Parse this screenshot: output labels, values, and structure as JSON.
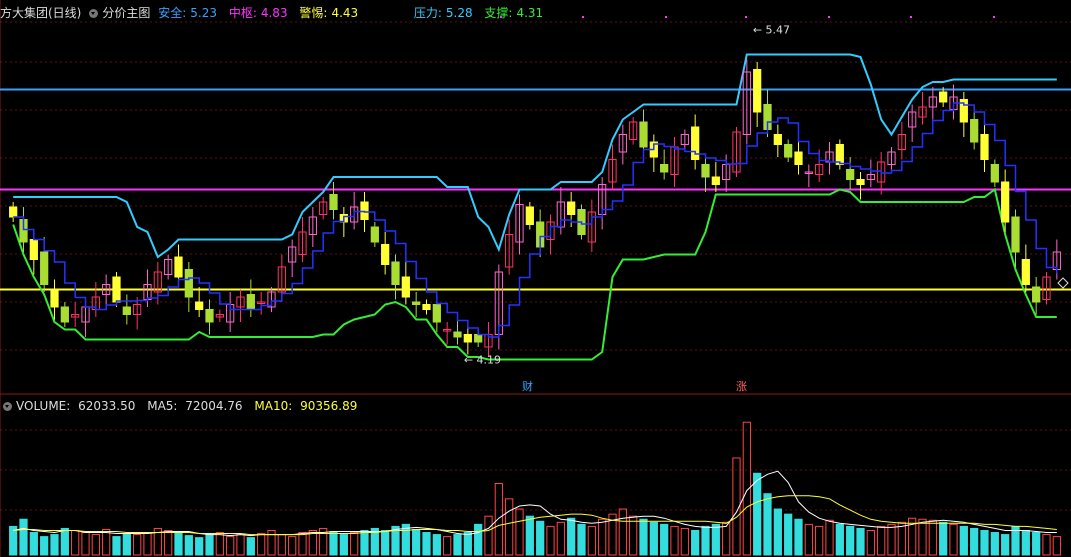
{
  "header": {
    "stock_name": "方大集团(日线)",
    "main_chart_label": "分价主图",
    "safe": {
      "label": "安全:",
      "value": "5.23",
      "color": "#3aa0ff"
    },
    "center": {
      "label": "中枢:",
      "value": "4.83",
      "color": "#ff33ff"
    },
    "alert": {
      "label": "警惕:",
      "value": "4.43",
      "color": "#ffff33"
    },
    "pressure": {
      "label": "压力:",
      "value": "5.28",
      "color": "#33ccff"
    },
    "support": {
      "label": "支撑:",
      "value": "4.31",
      "color": "#33ee33"
    }
  },
  "volume_header": {
    "volume": {
      "label": "VOLUME:",
      "value": "62033.50",
      "color": "#dddddd"
    },
    "ma5": {
      "label": "MA5:",
      "value": "72004.76",
      "color": "#dddddd"
    },
    "ma10": {
      "label": "MA10:",
      "value": "90356.89",
      "color": "#ffff33"
    }
  },
  "markers": {
    "high_label": "5.47",
    "low_label": "4.19",
    "cai_badge": "财",
    "zhang_badge": "涨"
  },
  "chart_data": {
    "type": "candlestick",
    "price_range": [
      4.1,
      5.5
    ],
    "ref_lines": [
      {
        "name": "安全",
        "value": 5.23,
        "color": "#3aa0ff"
      },
      {
        "name": "中枢",
        "value": 4.83,
        "color": "#ff33ff"
      },
      {
        "name": "警惕",
        "value": 4.43,
        "color": "#ffff33"
      }
    ],
    "closes": [
      4.72,
      4.62,
      4.55,
      4.45,
      4.36,
      4.3,
      4.33,
      4.36,
      4.4,
      4.45,
      4.38,
      4.33,
      4.37,
      4.45,
      4.5,
      4.55,
      4.48,
      4.4,
      4.35,
      4.3,
      4.33,
      4.37,
      4.4,
      4.35,
      4.38,
      4.42,
      4.52,
      4.6,
      4.66,
      4.72,
      4.78,
      4.75,
      4.7,
      4.76,
      4.71,
      4.62,
      4.53,
      4.45,
      4.4,
      4.37,
      4.35,
      4.3,
      4.27,
      4.24,
      4.22,
      4.22,
      4.25,
      4.5,
      4.65,
      4.77,
      4.69,
      4.6,
      4.7,
      4.78,
      4.73,
      4.65,
      4.74,
      4.85,
      4.95,
      5.05,
      5.1,
      5.0,
      4.96,
      4.9,
      5.0,
      5.05,
      4.95,
      4.88,
      4.85,
      4.93,
      5.06,
      5.3,
      5.14,
      5.07,
      5.01,
      4.96,
      4.93,
      4.9,
      4.93,
      4.98,
      4.93,
      4.87,
      4.85,
      4.89,
      4.94,
      4.98,
      5.05,
      5.14,
      5.16,
      5.2,
      5.18,
      5.2,
      5.1,
      5.02,
      4.95,
      4.86,
      4.7,
      4.58,
      4.45,
      4.38,
      4.48,
      4.58
    ],
    "volume_range": [
      0,
      140000
    ],
    "volumes": [
      28000,
      35000,
      22000,
      18000,
      20000,
      26000,
      24000,
      22000,
      20000,
      25000,
      18000,
      21000,
      20000,
      22000,
      26000,
      24000,
      22000,
      19000,
      17000,
      20000,
      22000,
      18000,
      20000,
      17000,
      21000,
      24000,
      20000,
      18000,
      22000,
      24000,
      26000,
      23000,
      20000,
      22000,
      24000,
      26000,
      24000,
      28000,
      30000,
      25000,
      22000,
      20000,
      18000,
      20000,
      22000,
      30000,
      38000,
      70000,
      55000,
      45000,
      38000,
      33000,
      28000,
      32000,
      36000,
      30000,
      28000,
      35000,
      40000,
      45000,
      38000,
      35000,
      32000,
      30000,
      28000,
      26000,
      24000,
      28000,
      30000,
      32000,
      95000,
      130000,
      80000,
      60000,
      45000,
      40000,
      35000,
      30000,
      28000,
      34000,
      30000,
      28000,
      26000,
      24000,
      28000,
      30000,
      32000,
      36000,
      35000,
      34000,
      32000,
      30000,
      28000,
      26000,
      24000,
      22000,
      20000,
      28000,
      24000,
      22000,
      20000,
      18000
    ],
    "ma5_values": [
      24000,
      26000,
      24000,
      23000,
      22000,
      24000,
      24000,
      22000,
      22000,
      22000,
      21000,
      21000,
      21000,
      21000,
      22000,
      23000,
      23000,
      23000,
      21000,
      20000,
      20000,
      19000,
      20000,
      19000,
      20000,
      20000,
      20000,
      20000,
      21000,
      22000,
      22000,
      23000,
      23000,
      23000,
      23000,
      23000,
      23000,
      25000,
      26000,
      27000,
      26000,
      25000,
      23000,
      21000,
      20000,
      22000,
      26000,
      36000,
      43000,
      48000,
      49000,
      48000,
      40000,
      35000,
      34000,
      32000,
      31000,
      32000,
      34000,
      36000,
      37000,
      38000,
      38000,
      36000,
      33000,
      30000,
      28000,
      27000,
      27000,
      28000,
      42000,
      63000,
      73000,
      79000,
      82000,
      71000,
      52000,
      42000,
      36000,
      33000,
      31000,
      30000,
      29000,
      28000,
      27000,
      27000,
      28000,
      30000,
      32000,
      33000,
      34000,
      33000,
      32000,
      30000,
      28000,
      26000,
      24000,
      24000,
      24000,
      23000,
      22000,
      22000
    ],
    "ma10_values": [
      24000,
      25000,
      25000,
      24000,
      24000,
      24000,
      24000,
      23000,
      23000,
      23000,
      23000,
      22000,
      22000,
      22000,
      22000,
      22000,
      22000,
      22000,
      21000,
      21000,
      21000,
      21000,
      21000,
      20000,
      20000,
      20000,
      20000,
      20000,
      20000,
      21000,
      21000,
      21000,
      21000,
      21000,
      22000,
      22000,
      23000,
      24000,
      24000,
      25000,
      25000,
      25000,
      24000,
      24000,
      23000,
      23000,
      24000,
      29000,
      31000,
      33000,
      35000,
      37000,
      38000,
      39000,
      40000,
      40000,
      39000,
      36000,
      34000,
      33000,
      33000,
      33000,
      33000,
      33000,
      33000,
      33000,
      33000,
      33000,
      32000,
      31000,
      37000,
      47000,
      52000,
      55000,
      57000,
      58000,
      58000,
      58000,
      57000,
      55000,
      49000,
      44000,
      39000,
      35000,
      33000,
      32000,
      31000,
      31000,
      31000,
      31000,
      31000,
      31000,
      31000,
      31000,
      30000,
      30000,
      29000,
      28000,
      28000,
      27000,
      26000,
      25000
    ]
  }
}
